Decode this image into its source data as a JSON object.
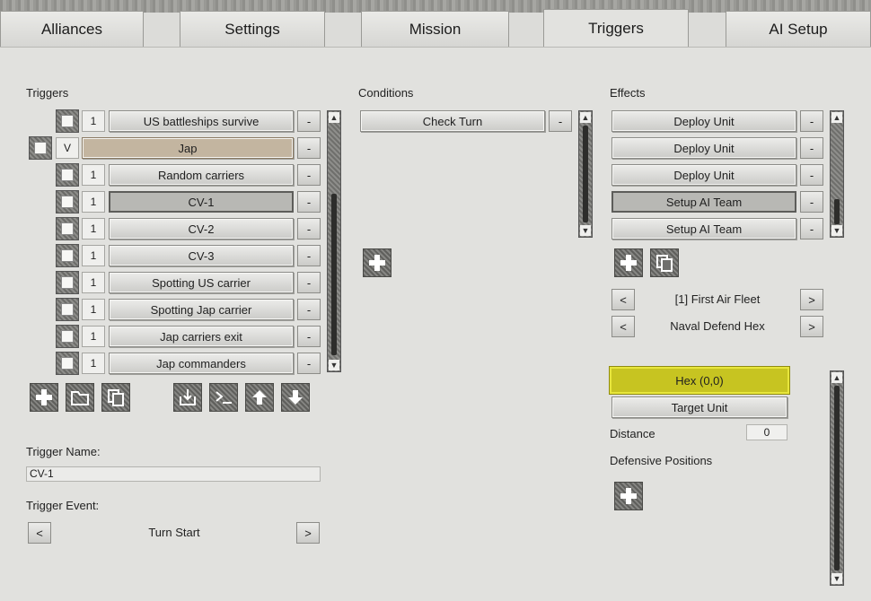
{
  "tabs": [
    {
      "label": "Alliances"
    },
    {
      "label": "Settings"
    },
    {
      "label": "Mission"
    },
    {
      "label": "Triggers"
    },
    {
      "label": "AI Setup"
    }
  ],
  "triggers": {
    "heading": "Triggers",
    "remove_label": "-",
    "items": [
      {
        "num": "1",
        "name": "US battleships survive"
      },
      {
        "num": "V",
        "name": "Jap"
      },
      {
        "num": "1",
        "name": "Random carriers"
      },
      {
        "num": "1",
        "name": "CV-1"
      },
      {
        "num": "1",
        "name": "CV-2"
      },
      {
        "num": "1",
        "name": "CV-3"
      },
      {
        "num": "1",
        "name": "Spotting US carrier"
      },
      {
        "num": "1",
        "name": "Spotting Jap carrier"
      },
      {
        "num": "1",
        "name": "Jap carriers exit"
      },
      {
        "num": "1",
        "name": "Jap commanders"
      }
    ]
  },
  "conditions": {
    "heading": "Conditions",
    "items": [
      {
        "name": "Check Turn"
      }
    ],
    "remove_label": "-"
  },
  "effects": {
    "heading": "Effects",
    "items": [
      {
        "name": "Deploy Unit"
      },
      {
        "name": "Deploy Unit"
      },
      {
        "name": "Deploy Unit"
      },
      {
        "name": "Setup AI Team"
      },
      {
        "name": "Setup AI Team"
      }
    ],
    "remove_label": "-",
    "team_selector": {
      "prev": "<",
      "value": "[1] First Air Fleet",
      "next": ">"
    },
    "order_selector": {
      "prev": "<",
      "value": "Naval Defend Hex",
      "next": ">"
    },
    "hex_button": "Hex (0,0)",
    "target_unit_button": "Target Unit",
    "distance_label": "Distance",
    "distance_value": "0",
    "defensive_positions_label": "Defensive Positions"
  },
  "trigger_name": {
    "label": "Trigger Name:",
    "value": "CV-1"
  },
  "trigger_event": {
    "label": "Trigger Event:",
    "prev": "<",
    "value": "Turn Start",
    "next": ">"
  },
  "colors": {
    "highlight": "#c7c421",
    "selected_row": "#c3b5a0"
  },
  "icons": [
    "plus-icon",
    "folder-icon",
    "copy-icon",
    "import-icon",
    "console-icon",
    "arrow-up-icon",
    "arrow-down-icon"
  ]
}
